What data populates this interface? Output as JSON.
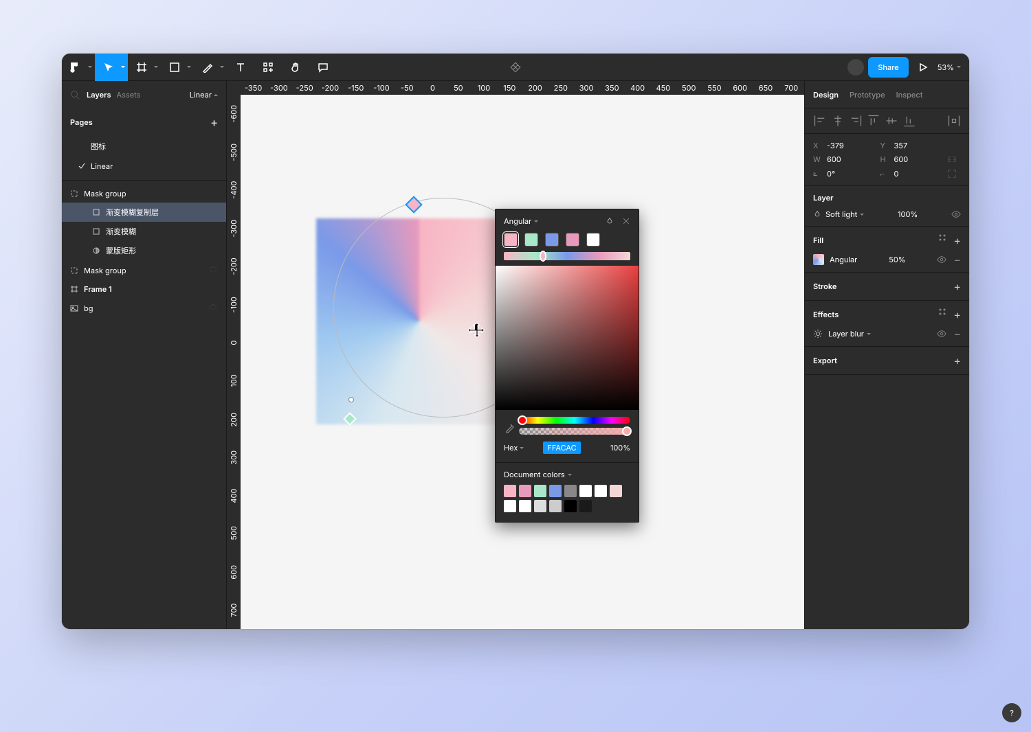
{
  "toolbar": {
    "share_label": "Share",
    "zoom": "53%"
  },
  "left_panel": {
    "tabs": {
      "layers": "Layers",
      "assets": "Assets"
    },
    "linear_btn": "Linear",
    "pages_label": "Pages",
    "pages": [
      {
        "name": "图标",
        "active": false
      },
      {
        "name": "Linear",
        "active": true
      }
    ],
    "layers": [
      {
        "name": "Mask group",
        "icon": "mask",
        "indent": 0
      },
      {
        "name": "渐变模糊复制层",
        "icon": "rect",
        "indent": 2,
        "selected": true
      },
      {
        "name": "渐变模糊",
        "icon": "rect",
        "indent": 2
      },
      {
        "name": "蒙版矩形",
        "icon": "half",
        "indent": 2
      },
      {
        "name": "Mask group",
        "icon": "mask",
        "indent": 0,
        "hidden": true
      },
      {
        "name": "Frame 1",
        "icon": "frame",
        "indent": 0,
        "bold": true
      },
      {
        "name": "bg",
        "icon": "image",
        "indent": 0,
        "hidden": true
      }
    ]
  },
  "ruler_h": [
    "-350",
    "-300",
    "-250",
    "-200",
    "-150",
    "-100",
    "-50",
    "0",
    "50",
    "100",
    "150",
    "200",
    "250",
    "300",
    "350",
    "400",
    "450",
    "500",
    "550",
    "600",
    "650",
    "700"
  ],
  "ruler_v": [
    "-600",
    "-500",
    "-400",
    "-300",
    "-200",
    "-100",
    "0",
    "100",
    "200",
    "300",
    "400",
    "500",
    "600",
    "700"
  ],
  "right_panel": {
    "tabs": {
      "design": "Design",
      "prototype": "Prototype",
      "inspect": "Inspect"
    },
    "props": {
      "x_lbl": "X",
      "x": "-379",
      "y_lbl": "Y",
      "y": "357",
      "w_lbl": "W",
      "w": "600",
      "h_lbl": "H",
      "h": "600",
      "r_lbl": "⟀",
      "r": "0°",
      "c_lbl": "⌐",
      "c": "0"
    },
    "layer": {
      "title": "Layer",
      "blend": "Soft light",
      "opacity": "100%"
    },
    "fill": {
      "title": "Fill",
      "type": "Angular",
      "opacity": "50%"
    },
    "stroke": {
      "title": "Stroke"
    },
    "effects": {
      "title": "Effects",
      "type": "Layer blur"
    },
    "export": {
      "title": "Export"
    }
  },
  "picker": {
    "title": "Angular",
    "gradient_stops": [
      "#f8b4c4",
      "#a8e8c8",
      "#7a9ae8",
      "#e89abc",
      "#ffffff"
    ],
    "grad_thumb_pos": "28%",
    "hex_label": "Hex",
    "hex_value": "FFACAC",
    "hex_opacity": "100%",
    "doc_colors_label": "Document colors",
    "doc_colors": [
      "#f8b4c4",
      "#e89abc",
      "#a8e8c8",
      "#7a9ae8",
      "#888888",
      "#ffffff",
      "#ffffff",
      "#f5d6d6",
      "#ffffff",
      "#ffffff",
      "#dddddd",
      "#cccccc",
      "#000000",
      "#1a1a1a"
    ]
  },
  "help": "?"
}
